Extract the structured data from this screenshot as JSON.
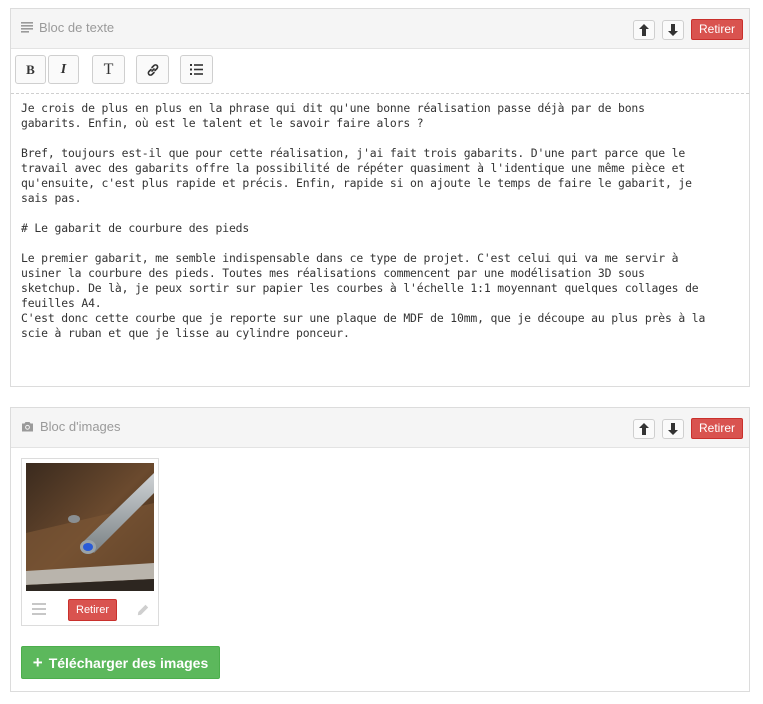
{
  "text_block": {
    "title": "Bloc de texte",
    "remove_label": "Retirer",
    "toolbar": {
      "bold": "B",
      "italic": "I",
      "heading": "T"
    },
    "content": "Je crois de plus en plus en la phrase qui dit qu'une bonne réalisation passe déjà par de bons\ngabarits. Enfin, où est le talent et le savoir faire alors ?\n\nBref, toujours est-il que pour cette réalisation, j'ai fait trois gabarits. D'une part parce que le\ntravail avec des gabarits offre la possibilité de répéter quasiment à l'identique une même pièce et\nqu'ensuite, c'est plus rapide et précis. Enfin, rapide si on ajoute le temps de faire le gabarit, je\nsais pas.\n\n# Le gabarit de courbure des pieds\n\nLe premier gabarit, me semble indispensable dans ce type de projet. C'est celui qui va me servir à\nusiner la courbure des pieds. Toutes mes réalisations commencent par une modélisation 3D sous\nsketchup. De là, je peux sortir sur papier les courbes à l'échelle 1:1 moyennant quelques collages de\nfeuilles A4.\nC'est donc cette courbe que je reporte sur une plaque de MDF de 10mm, que je découpe au plus près à la\nscie à ruban et que je lisse au cylindre ponceur."
  },
  "image_block": {
    "title": "Bloc d'images",
    "remove_label": "Retirer",
    "card_remove_label": "Retirer",
    "upload_label": "Télécharger des images",
    "upload_icon": "+"
  },
  "colors": {
    "danger": "#d9534f",
    "success": "#5cb85c"
  }
}
